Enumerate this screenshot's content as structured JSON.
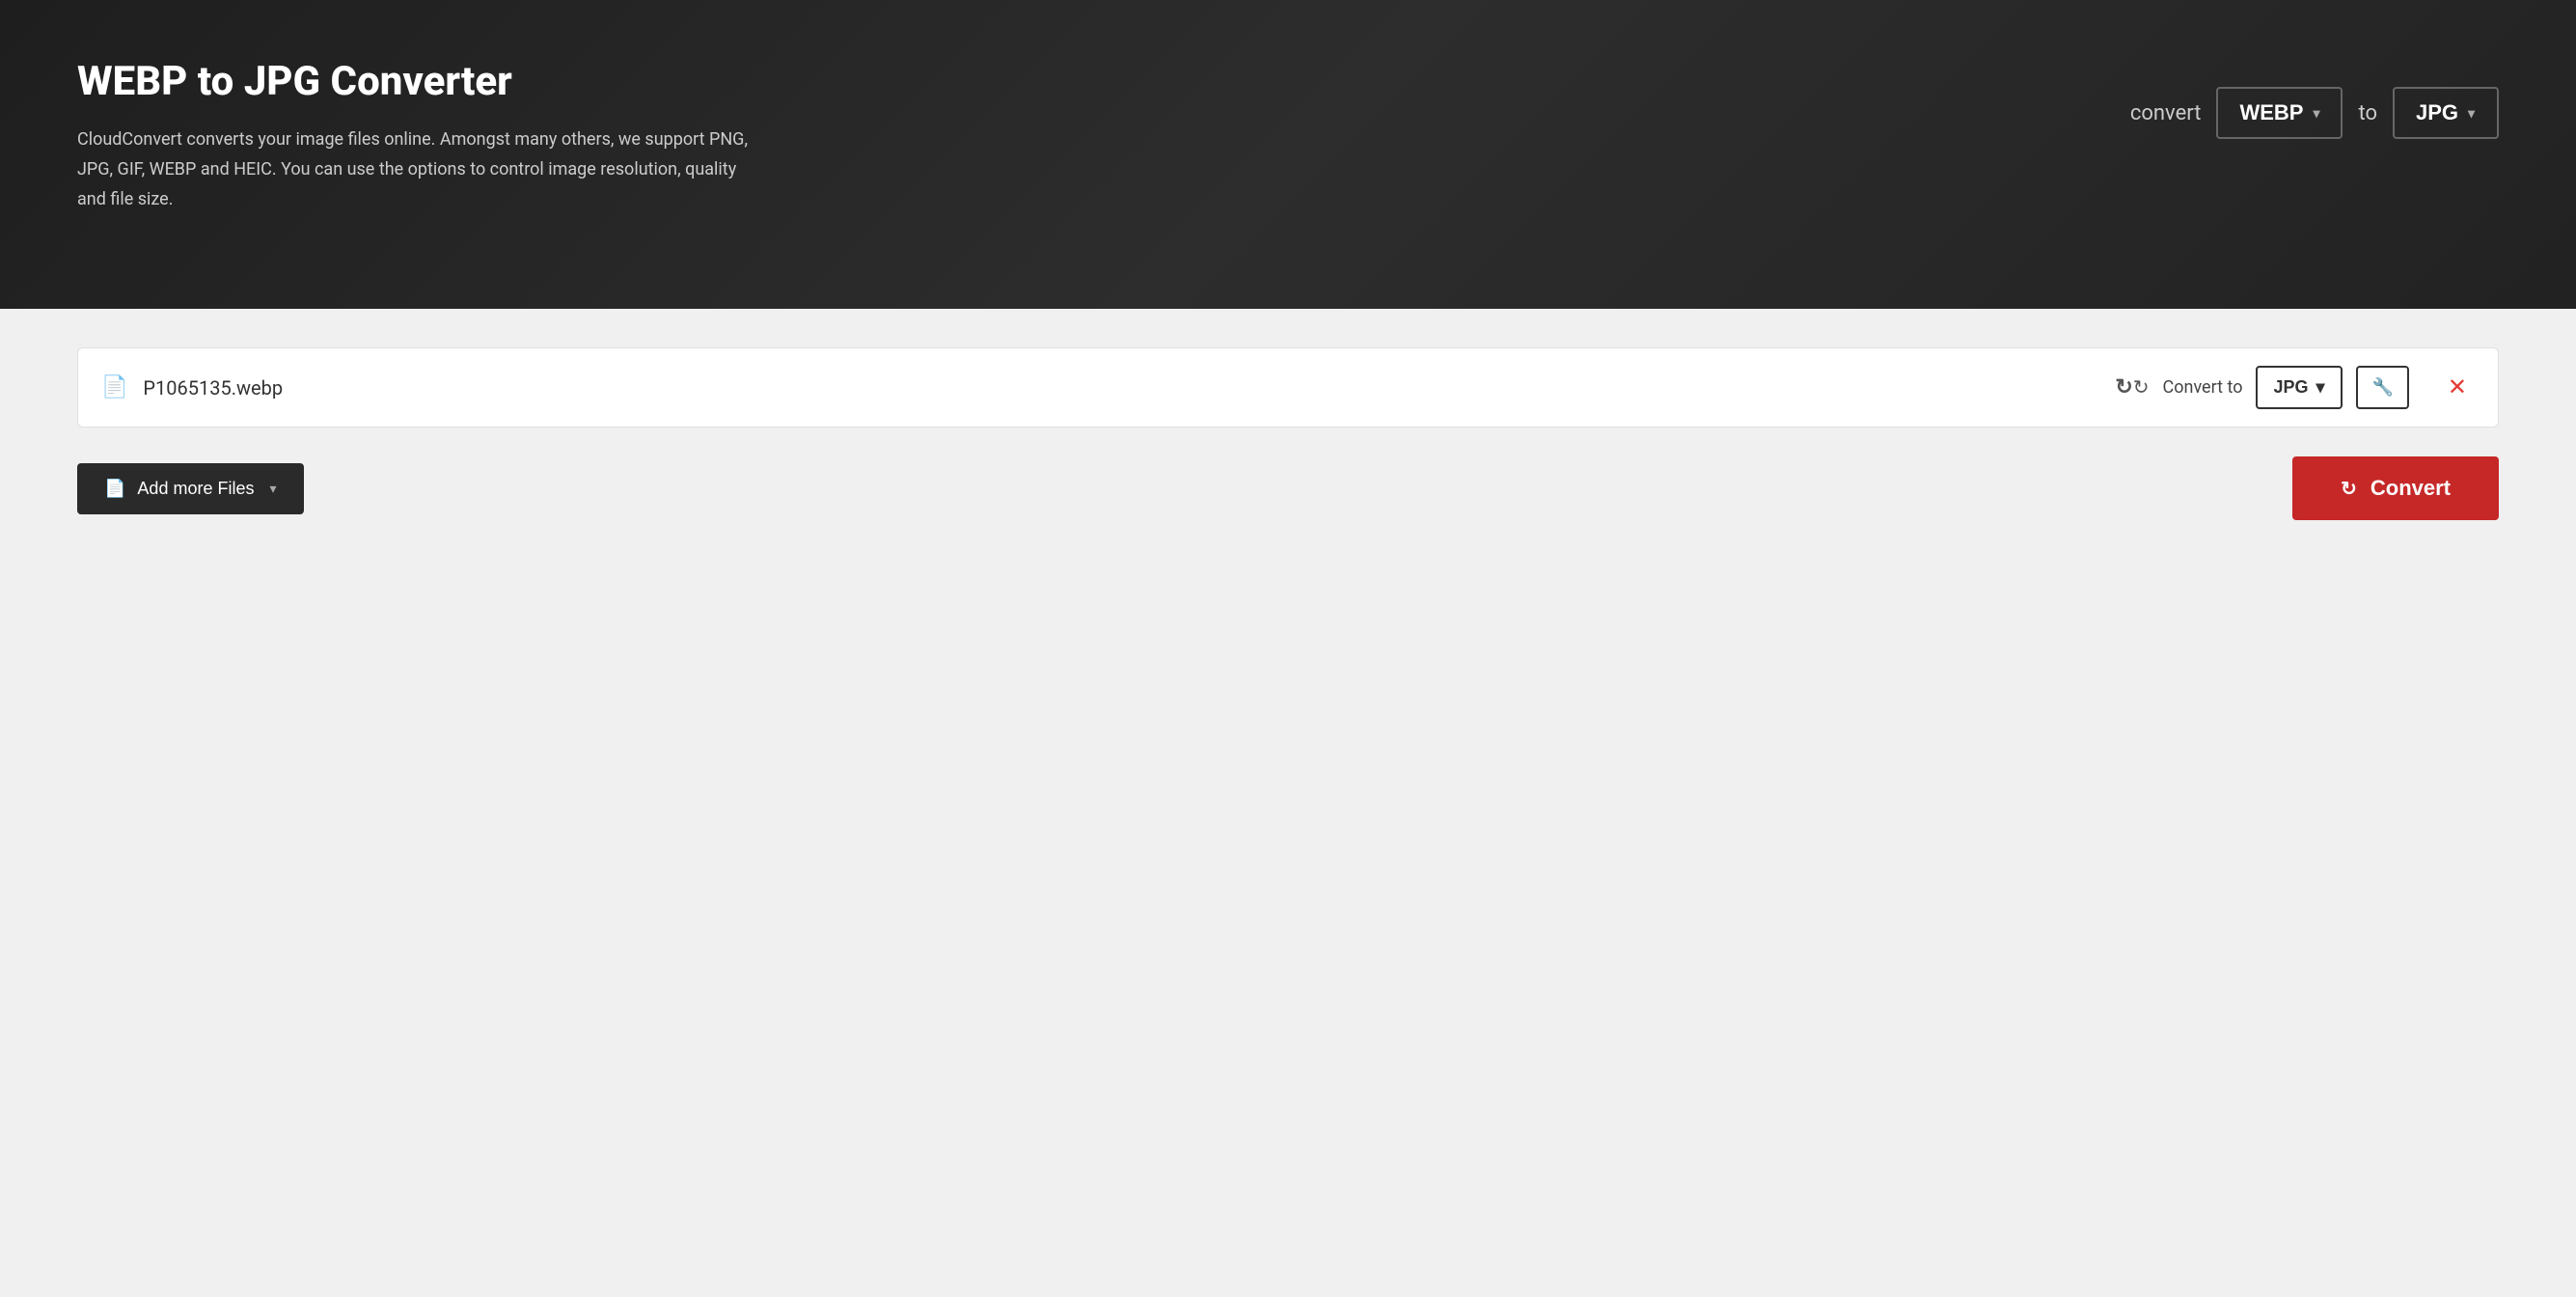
{
  "header": {
    "title": "WEBP to JPG Converter",
    "description": "CloudConvert converts your image files online. Amongst many others, we support PNG, JPG, GIF, WEBP and HEIC. You can use the options to control image resolution, quality and file size.",
    "convert_label": "convert",
    "from_format": "WEBP",
    "to_text": "to",
    "to_format": "JPG"
  },
  "file_row": {
    "file_icon_label": "file-icon",
    "file_name": "P1065135.webp",
    "convert_to_label": "Convert to",
    "format": "JPG",
    "refresh_icon_label": "refresh-icon",
    "wrench_icon_label": "wrench-icon",
    "close_icon_label": "close-icon"
  },
  "toolbar": {
    "add_files_label": "Add more Files",
    "convert_label": "Convert",
    "chevron_down": "▾",
    "refresh_icon": "↻",
    "close_icon": "✕"
  },
  "colors": {
    "header_bg": "#2a2a2a",
    "convert_button_bg": "#c62828",
    "add_files_bg": "#2a2a2a",
    "close_color": "#e53935"
  }
}
